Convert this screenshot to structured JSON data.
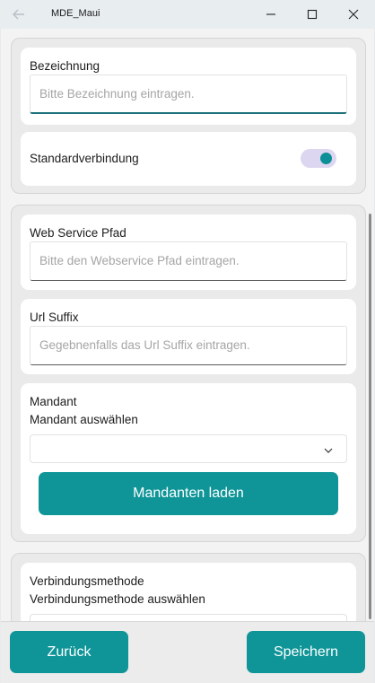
{
  "window": {
    "title": "MDE_Maui"
  },
  "group1": {
    "bezeichnung": {
      "label": "Bezeichnung",
      "placeholder": "Bitte Bezeichnung eintragen."
    },
    "standard": {
      "label": "Standardverbindung",
      "toggle_on": true
    }
  },
  "group2": {
    "webservice": {
      "label": "Web Service Pfad",
      "placeholder": "Bitte den Webservice Pfad eintragen."
    },
    "urlsuffix": {
      "label": "Url Suffix",
      "placeholder": "Gegebnenfalls das Url Suffix eintragen."
    },
    "mandant": {
      "label": "Mandant",
      "sublabel": "Mandant auswählen",
      "selected": "",
      "button": "Mandanten laden"
    }
  },
  "group3": {
    "verbindung": {
      "label": "Verbindungsmethode",
      "sublabel": "Verbindungsmethode auswählen"
    }
  },
  "footer": {
    "back": "Zurück",
    "save": "Speichern"
  },
  "colors": {
    "accent": "#0f9598",
    "toggle_track": "#dcd6f0"
  }
}
